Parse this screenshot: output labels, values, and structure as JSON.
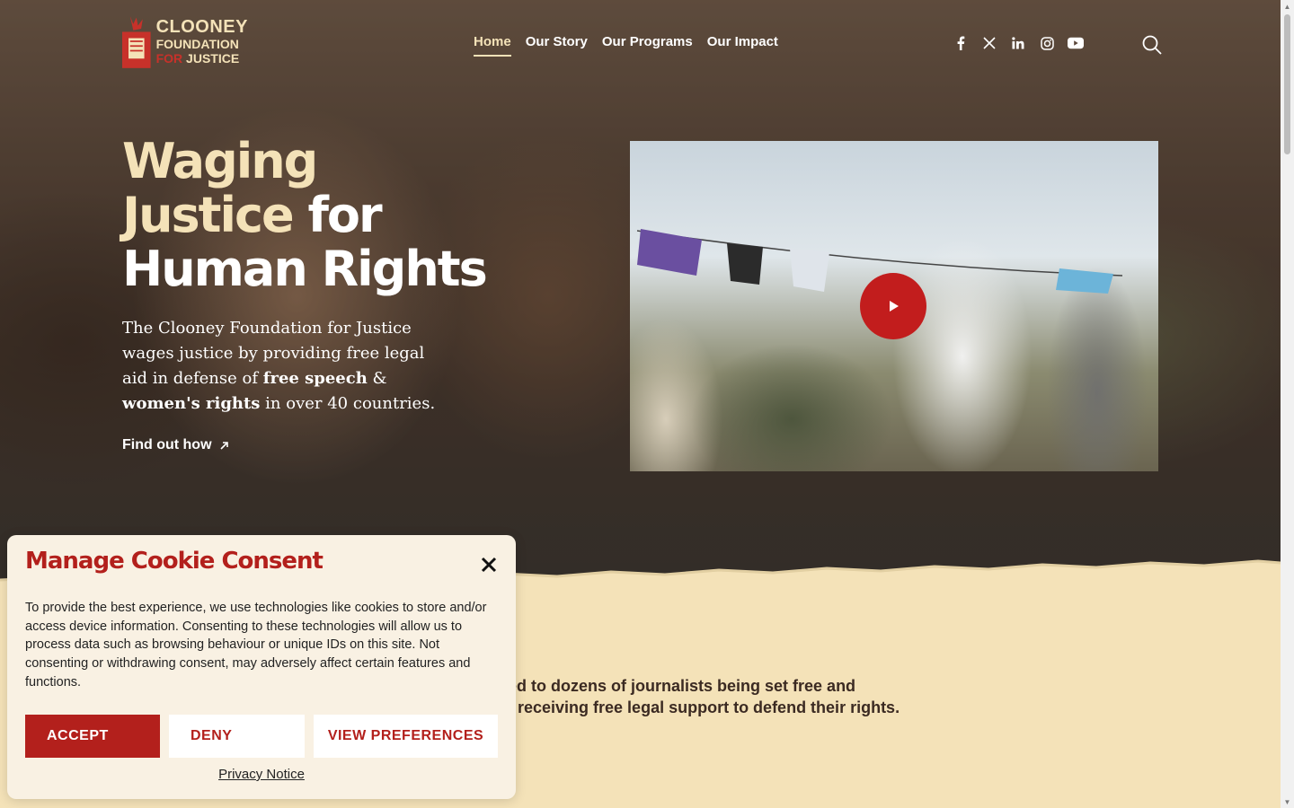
{
  "header": {
    "logo": {
      "line1": "CLOONEY",
      "line2": "FOUNDATION",
      "line3_for": "FOR",
      "line3_rest": " JUSTICE"
    },
    "nav": [
      {
        "label": "Home",
        "active": true
      },
      {
        "label": "Our Story",
        "active": false
      },
      {
        "label": "Our Programs",
        "active": false
      },
      {
        "label": "Our Impact",
        "active": false
      }
    ],
    "social": [
      "facebook-icon",
      "x-icon",
      "linkedin-icon",
      "instagram-icon",
      "youtube-icon"
    ]
  },
  "hero": {
    "headline_1": "Waging",
    "headline_2": "Justice",
    "headline_3": " for",
    "headline_4": "Human Rights",
    "sub_1": "The Clooney Foundation for Justice wages justice by providing free legal aid in defense of ",
    "sub_bold_1": "free speech",
    "sub_2": " & ",
    "sub_bold_2": "women's rights",
    "sub_3": " in over 40 countries.",
    "cta": "Find out how"
  },
  "video": {
    "play_icon": "play-icon"
  },
  "impact": {
    "line_1": "led to dozens of journalists being set free and",
    "line_2": "n receiving free legal support to defend their rights."
  },
  "cookie": {
    "title": "Manage Cookie Consent",
    "body": "To provide the best experience, we use technologies like cookies to store and/or access device information. Consenting to these technologies will allow us to process data such as browsing behaviour or unique IDs on this site. Not consenting or withdrawing consent, may adversely affect certain features and functions.",
    "accept": "ACCEPT",
    "deny": "DENY",
    "preferences": "VIEW PREFERENCES",
    "privacy": "Privacy Notice"
  },
  "colors": {
    "brand_red": "#b3201c",
    "cream": "#f4e2b8"
  }
}
